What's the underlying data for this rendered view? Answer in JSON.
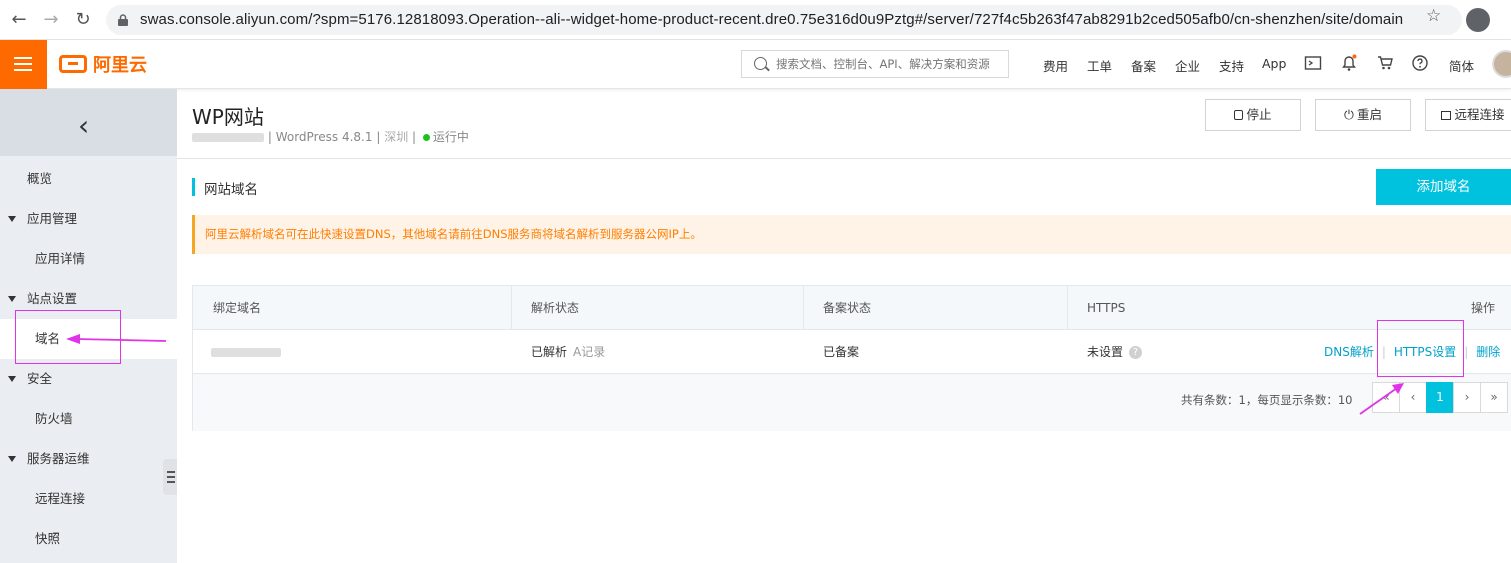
{
  "browser": {
    "url": "swas.console.aliyun.com/?spm=5176.12818093.Operation--ali--widget-home-product-recent.dre0.75e316d0u9Pztg#/server/727f4c5b263f47ab8291b2ced505afb0/cn-shenzhen/site/domain"
  },
  "topbar": {
    "logo": "阿里云",
    "search_placeholder": "搜索文档、控制台、API、解决方案和资源",
    "nav": [
      "费用",
      "工单",
      "备案",
      "企业",
      "支持",
      "App"
    ],
    "lang": "简体",
    "icons": [
      "terminal-icon",
      "bell-icon",
      "cart-icon",
      "help-icon"
    ],
    "brand_color": "#ff6a00"
  },
  "sidebar": {
    "items": [
      {
        "label": "概览",
        "type": "item"
      },
      {
        "label": "应用管理",
        "type": "group"
      },
      {
        "label": "应用详情",
        "type": "sub"
      },
      {
        "label": "站点设置",
        "type": "group"
      },
      {
        "label": "域名",
        "type": "sub",
        "active": true
      },
      {
        "label": "安全",
        "type": "group"
      },
      {
        "label": "防火墙",
        "type": "sub"
      },
      {
        "label": "服务器运维",
        "type": "group"
      },
      {
        "label": "远程连接",
        "type": "sub"
      },
      {
        "label": "快照",
        "type": "sub"
      }
    ]
  },
  "header": {
    "title": "WP网站",
    "app_version": "WordPress 4.8.1",
    "sep": "|",
    "region": "深圳",
    "status": "运行中",
    "buttons": {
      "stop": "停止",
      "restart": "重启",
      "remote": "远程连接"
    }
  },
  "section": {
    "title": "网站域名",
    "add_button": "添加域名",
    "notice": "阿里云解析域名可在此快速设置DNS，其他域名请前往DNS服务商将域名解析到服务器公网IP上。",
    "accent": "#00c1de"
  },
  "table": {
    "columns": [
      "绑定域名",
      "解析状态",
      "备案状态",
      "HTTPS",
      "操作"
    ],
    "rows": [
      {
        "resolve_status": "已解析",
        "resolve_type": "A记录",
        "icp_status": "已备案",
        "https": "未设置",
        "actions": [
          "DNS解析",
          "HTTPS设置",
          "删除"
        ]
      }
    ],
    "pagination": {
      "info": "共有条数：1，每页显示条数：10",
      "first": "«",
      "prev": "‹",
      "current": "1",
      "next": "›",
      "last": "»"
    }
  }
}
